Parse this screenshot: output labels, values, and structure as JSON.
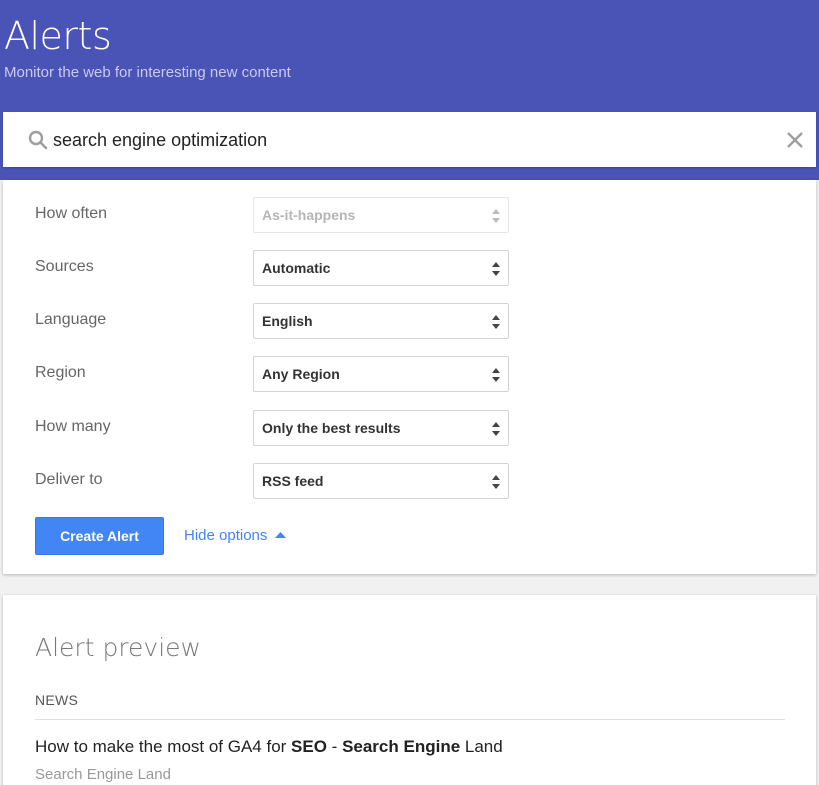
{
  "header": {
    "title": "Alerts",
    "subtitle": "Monitor the web for interesting new content",
    "background_color": "#4a53b6"
  },
  "search": {
    "value": "search engine optimization",
    "search_icon": "search-icon",
    "clear_icon": "close-icon"
  },
  "options": [
    {
      "label": "How often",
      "value": "As-it-happens",
      "disabled": true
    },
    {
      "label": "Sources",
      "value": "Automatic",
      "disabled": false
    },
    {
      "label": "Language",
      "value": "English",
      "disabled": false
    },
    {
      "label": "Region",
      "value": "Any Region",
      "disabled": false
    },
    {
      "label": "How many",
      "value": "Only the best results",
      "disabled": false
    },
    {
      "label": "Deliver to",
      "value": "RSS feed",
      "disabled": false
    }
  ],
  "actions": {
    "create_label": "Create Alert",
    "hide_options_label": "Hide options",
    "accent_color": "#4285f4"
  },
  "preview": {
    "title": "Alert preview",
    "section": "NEWS",
    "result": {
      "parts": [
        {
          "text": "How to make the most of GA4 for ",
          "bold": false
        },
        {
          "text": "SEO",
          "bold": true
        },
        {
          "text": " - ",
          "bold": false
        },
        {
          "text": "Search Engine",
          "bold": true
        },
        {
          "text": " Land",
          "bold": false
        }
      ],
      "source": "Search Engine Land"
    }
  }
}
